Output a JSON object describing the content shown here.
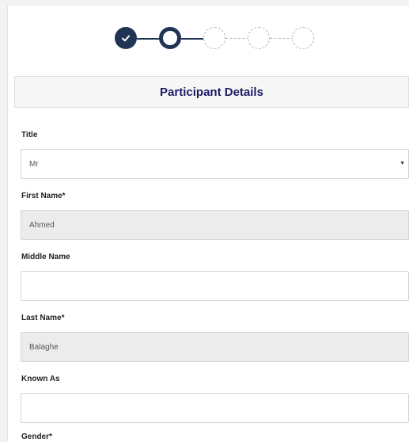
{
  "stepper": {
    "steps": [
      {
        "state": "done",
        "icon": "check-icon"
      },
      {
        "state": "current",
        "icon": "ring"
      },
      {
        "state": "todo"
      },
      {
        "state": "todo"
      },
      {
        "state": "todo"
      }
    ]
  },
  "section": {
    "title": "Participant Details"
  },
  "form": {
    "title": {
      "label": "Title",
      "value": "Mr",
      "dropdown_icon": "chevron-down-icon"
    },
    "first_name": {
      "label": "First Name*",
      "value": "Ahmed"
    },
    "middle_name": {
      "label": "Middle Name",
      "value": ""
    },
    "last_name": {
      "label": "Last Name*",
      "value": "Balaghe"
    },
    "known_as": {
      "label": "Known As",
      "value": ""
    },
    "gender": {
      "label": "Gender*"
    }
  },
  "colors": {
    "primary": "#1f3355",
    "header_text": "#1a1a66",
    "readonly_bg": "#ececec"
  }
}
